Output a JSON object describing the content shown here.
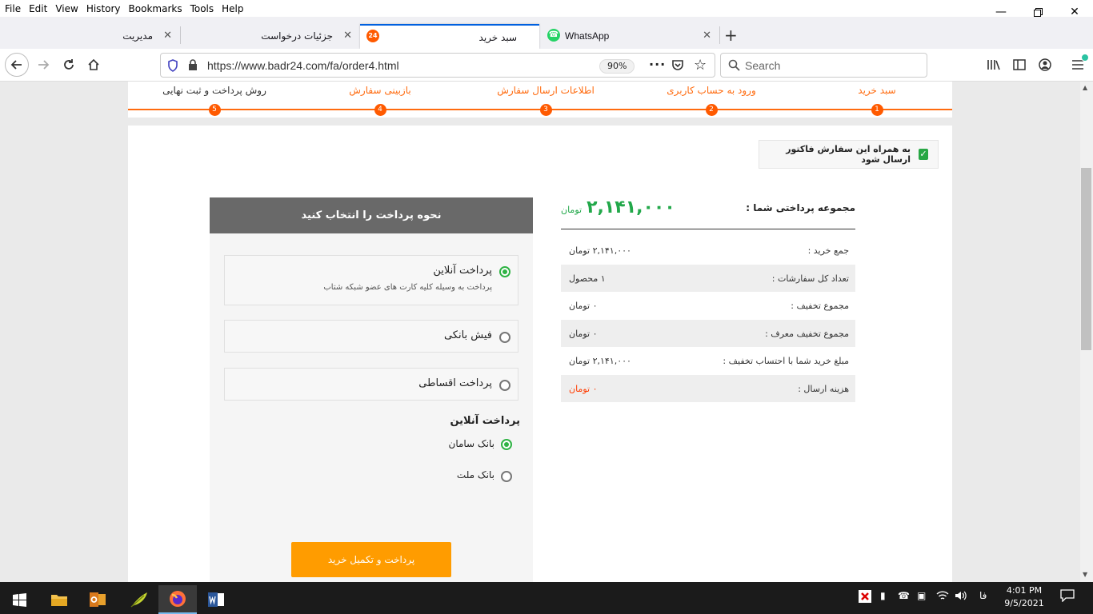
{
  "menu": [
    "File",
    "Edit",
    "View",
    "History",
    "Bookmarks",
    "Tools",
    "Help"
  ],
  "tabs": [
    {
      "label": "مدیریت"
    },
    {
      "label": "جزئیات درخواست"
    },
    {
      "label": "سبد خرید",
      "badge": "24"
    },
    {
      "label": "WhatsApp"
    }
  ],
  "nav": {
    "url": "https://www.badr24.com/fa/order4.html",
    "zoom": "90%",
    "search_placeholder": "Search"
  },
  "steps": [
    {
      "num": "1",
      "label": "سبد خرید"
    },
    {
      "num": "2",
      "label": "ورود به حساب کاربری"
    },
    {
      "num": "3",
      "label": "اطلاعات ارسال سفارش"
    },
    {
      "num": "4",
      "label": "بازبینی سفارش"
    },
    {
      "num": "5",
      "label": "روش پرداخت و ثبت نهایی"
    }
  ],
  "invoice": {
    "label": "به همراه این سفارش فاکتور ارسال شود",
    "checked": true
  },
  "summary": {
    "title": "مجموعه پرداختی شما :",
    "total": "۲,۱۴۱,۰۰۰",
    "currency": "تومان",
    "rows": [
      {
        "key": "جمع خرید :",
        "value": "۲,۱۴۱,۰۰۰ تومان"
      },
      {
        "key": "تعداد کل سفارشات :",
        "value": "۱ محصول"
      },
      {
        "key": "مجموع تخفیف :",
        "value": "۰ تومان"
      },
      {
        "key": "مجموع تخفیف معرف :",
        "value": "۰ تومان"
      },
      {
        "key": "مبلغ خرید شما با احتساب تخفیف :",
        "value": "۲,۱۴۱,۰۰۰ تومان"
      },
      {
        "key": "هزینه ارسال :",
        "value": "۰ تومان"
      }
    ]
  },
  "payment": {
    "header": "نحوه پرداخت را انتخاب کنید",
    "options": [
      {
        "title": "پرداخت آنلاین",
        "desc": "پرداخت به وسیله کلیه کارت های عضو شبکه شتاب",
        "selected": true
      },
      {
        "title": "فیش بانکی",
        "selected": false
      },
      {
        "title": "پرداخت اقساطی",
        "selected": false
      }
    ],
    "gateway_title": "پرداخت آنلاین",
    "banks": [
      {
        "name": "بانک سامان",
        "selected": true
      },
      {
        "name": "بانک ملت",
        "selected": false
      }
    ],
    "submit": "پرداخت و تکمیل خرید"
  },
  "taskbar": {
    "lang": "فا",
    "time": "4:01 PM",
    "date": "9/5/2021"
  },
  "colors": {
    "accent": "#ff6b0f",
    "green": "#22a84a",
    "button": "#ff9c00",
    "header": "#696969"
  }
}
